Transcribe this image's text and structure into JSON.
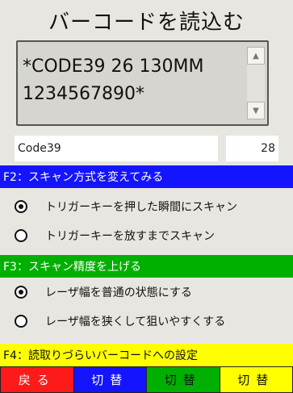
{
  "title": "バーコードを読込む",
  "scan": {
    "text": "*CODE39 26 130MM\n1234567890*"
  },
  "fields": {
    "symbology": "Code39",
    "length": "28"
  },
  "f2": {
    "header": "F2：スキャン方式を変えてみる",
    "options": [
      {
        "label": "トリガーキーを押した瞬間にスキャン",
        "checked": true
      },
      {
        "label": "トリガーキーを放すまでスキャン",
        "checked": false
      }
    ]
  },
  "f3": {
    "header": "F3：スキャン精度を上げる",
    "options": [
      {
        "label": "レーザ幅を普通の状態にする",
        "checked": true
      },
      {
        "label": "レーザ幅を狭くして狙いやすくする",
        "checked": false
      }
    ]
  },
  "f4": {
    "header": "F4：読取りづらいバーコードへの設定"
  },
  "buttons": {
    "back": "戻る",
    "switch_blue": "切替",
    "switch_green": "切替",
    "switch_yellow": "切替"
  },
  "colors": {
    "blue": "#1414ff",
    "green": "#00b000",
    "yellow": "#ffff00",
    "red": "#ff1a1a"
  }
}
